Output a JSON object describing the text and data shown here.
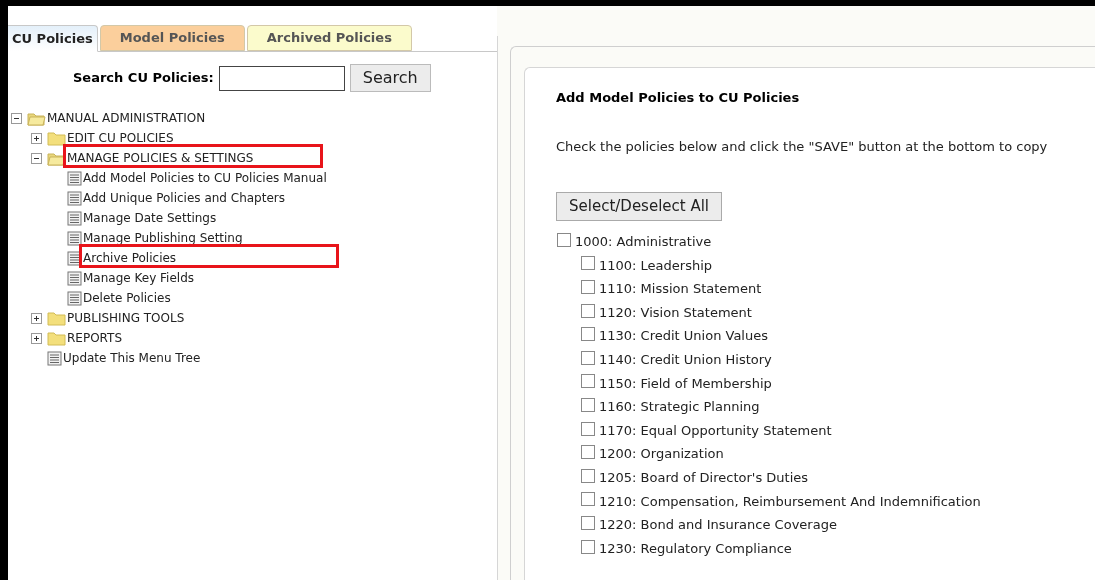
{
  "tabs": [
    {
      "label": "CU Policies",
      "selected": true,
      "color": "#e4f0fa"
    },
    {
      "label": "Model Policies",
      "selected": false,
      "color": "#fbcf9c"
    },
    {
      "label": "Archived Policies",
      "selected": false,
      "color": "#fbfbcc"
    }
  ],
  "search": {
    "label": "Search CU Policies:",
    "button": "Search"
  },
  "tree": [
    {
      "kind": "folder",
      "label": "MANUAL ADMINISTRATION",
      "expanded": true,
      "highlighted": false,
      "children": [
        {
          "kind": "folder",
          "label": "EDIT CU POLICIES",
          "expanded": false,
          "highlighted": false
        },
        {
          "kind": "folder",
          "label": "MANAGE POLICIES & SETTINGS",
          "expanded": true,
          "highlighted": true,
          "children": [
            {
              "kind": "page",
              "label": "Add Model Policies to CU Policies Manual",
              "highlighted": false
            },
            {
              "kind": "page",
              "label": "Add Unique Policies and Chapters",
              "highlighted": false
            },
            {
              "kind": "page",
              "label": "Manage Date Settings",
              "highlighted": false
            },
            {
              "kind": "page",
              "label": "Manage Publishing Setting",
              "highlighted": false
            },
            {
              "kind": "page",
              "label": "Archive Policies",
              "highlighted": true
            },
            {
              "kind": "page",
              "label": "Manage Key Fields",
              "highlighted": false
            },
            {
              "kind": "page",
              "label": "Delete Policies",
              "highlighted": false
            }
          ]
        },
        {
          "kind": "folder",
          "label": "PUBLISHING TOOLS",
          "expanded": false,
          "highlighted": false
        },
        {
          "kind": "folder",
          "label": "REPORTS",
          "expanded": false,
          "highlighted": false
        },
        {
          "kind": "page",
          "label": "Update This Menu Tree",
          "highlighted": false
        }
      ]
    }
  ],
  "panel": {
    "title": "Add Model Policies to CU Policies",
    "instructions": "Check the policies below and click the \"SAVE\" button at the bottom to copy",
    "select_all": "Select/Deselect All",
    "policies": [
      {
        "label": "1000: Administrative",
        "checked": false,
        "children": [
          {
            "label": "1100: Leadership",
            "checked": false
          },
          {
            "label": "1110: Mission Statement",
            "checked": false
          },
          {
            "label": "1120: Vision Statement",
            "checked": false
          },
          {
            "label": "1130: Credit Union Values",
            "checked": false
          },
          {
            "label": "1140: Credit Union History",
            "checked": false
          },
          {
            "label": "1150: Field of Membership",
            "checked": false
          },
          {
            "label": "1160: Strategic Planning",
            "checked": false
          },
          {
            "label": "1170: Equal Opportunity Statement",
            "checked": false
          },
          {
            "label": "1200: Organization",
            "checked": false
          },
          {
            "label": "1205: Board of Director's Duties",
            "checked": false
          },
          {
            "label": "1210: Compensation, Reimbursement And Indemnification",
            "checked": false
          },
          {
            "label": "1220: Bond and Insurance Coverage",
            "checked": false
          },
          {
            "label": "1230: Regulatory Compliance",
            "checked": false
          }
        ]
      }
    ]
  }
}
